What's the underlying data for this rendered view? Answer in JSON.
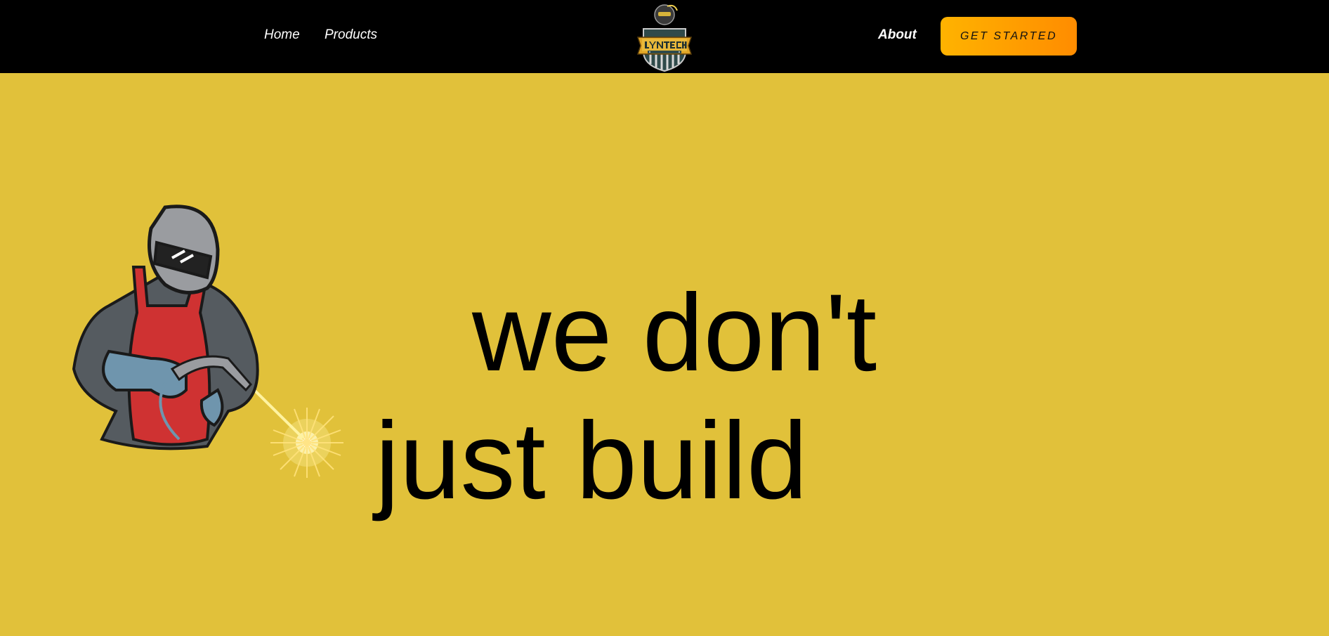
{
  "nav": {
    "home_label": "Home",
    "products_label": "Products",
    "about_label": "About",
    "cta_label": "GET STARTED"
  },
  "logo": {
    "icon": "welder-shield-logo"
  },
  "hero": {
    "headline_line1": "we don't",
    "headline_line2": "just build",
    "illustration": "welder-illustration"
  },
  "colors": {
    "nav_background": "#000000",
    "hero_background": "#e1c13a",
    "cta_gradient_start": "#ffb300",
    "cta_gradient_end": "#ff8c00",
    "nav_text": "#ffffff",
    "headline_text": "#000000"
  }
}
